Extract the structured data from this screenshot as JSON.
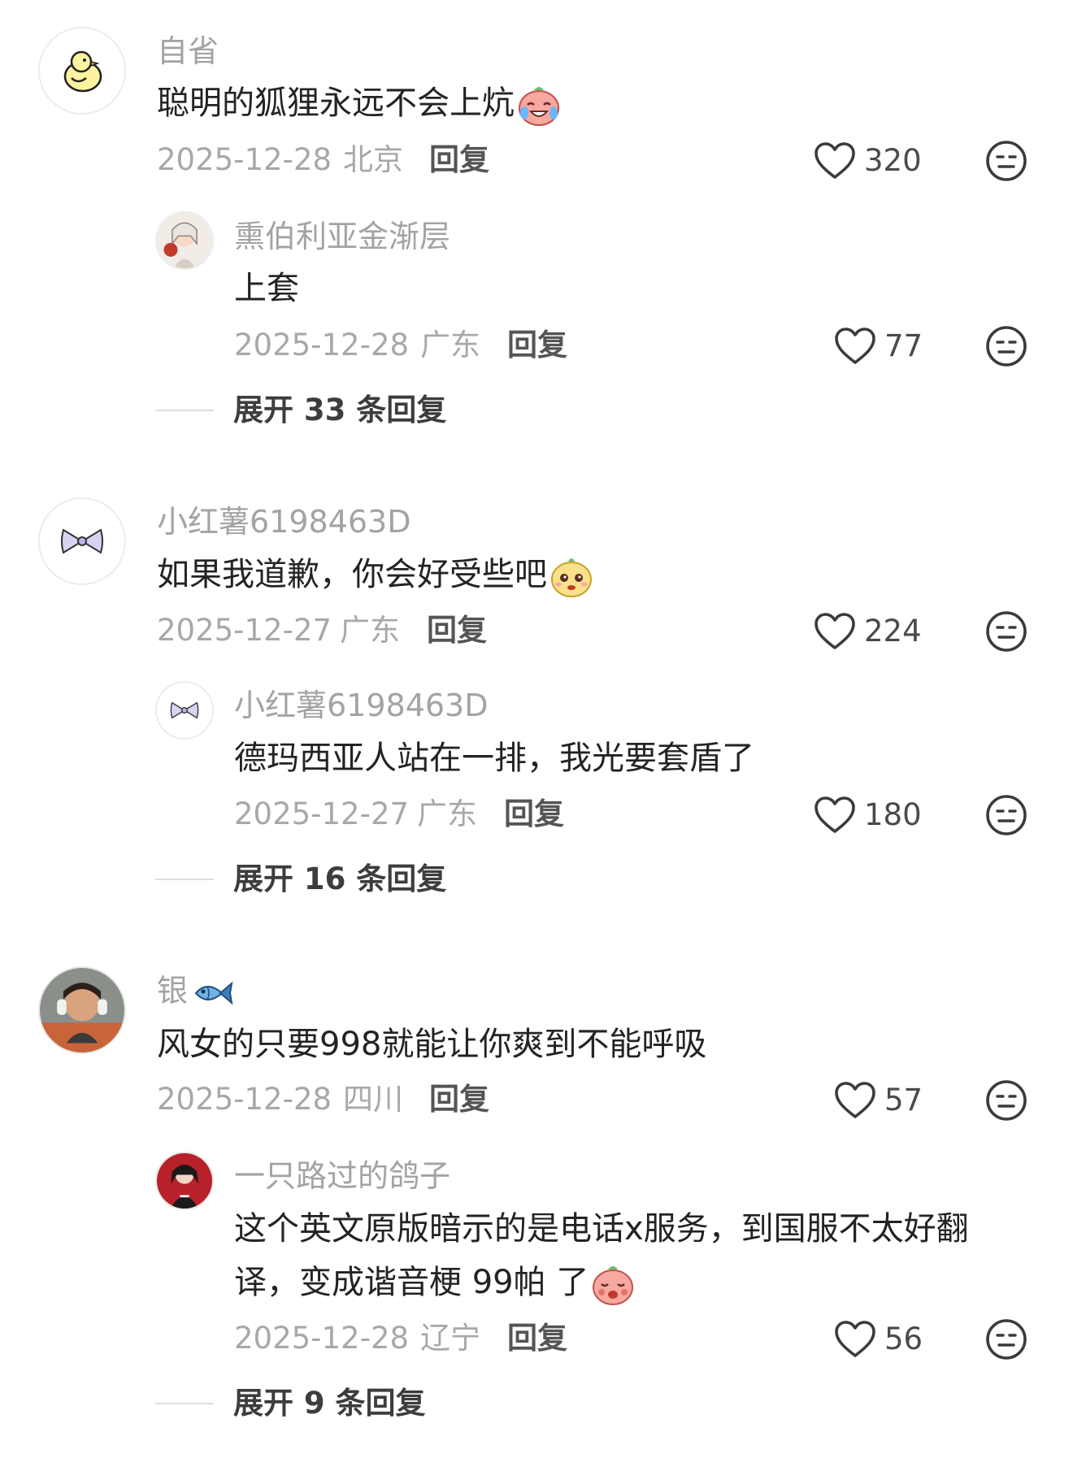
{
  "comments": [
    {
      "username": "自省",
      "text": "聪明的狐狸永远不会上炕",
      "date": "2025-12-28",
      "location": "北京",
      "reply_label": "回复",
      "likes": "320",
      "reply": {
        "username": "熏伯利亚金渐层",
        "text": "上套",
        "date": "2025-12-28",
        "location": "广东",
        "reply_label": "回复",
        "likes": "77"
      },
      "expand_label": "展开 33 条回复"
    },
    {
      "username": "小红薯6198463D",
      "text": "如果我道歉，你会好受些吧",
      "date": "2025-12-27",
      "location": "广东",
      "reply_label": "回复",
      "likes": "224",
      "reply": {
        "username": "小红薯6198463D",
        "text": "德玛西亚人站在一排，我光要套盾了",
        "date": "2025-12-27",
        "location": "广东",
        "reply_label": "回复",
        "likes": "180"
      },
      "expand_label": "展开 16 条回复"
    },
    {
      "username": "银",
      "text": "风女的只要998就能让你爽到不能呼吸",
      "date": "2025-12-28",
      "location": "四川",
      "reply_label": "回复",
      "likes": "57",
      "reply": {
        "username": "一只路过的鸽子",
        "text_line1": "这个英文原版暗示的是电话x服务，到国服不太好翻",
        "text_line2": "译，变成谐音梗 99帕 了",
        "date": "2025-12-28",
        "location": "辽宁",
        "reply_label": "回复",
        "likes": "56"
      },
      "expand_label": "展开 9 条回复"
    }
  ],
  "icons": {
    "like": "heart-outline-icon",
    "dislike": "neutral-face-icon"
  },
  "colors": {
    "username": "#a3a3a3",
    "text": "#232323",
    "meta": "#a8a8a8"
  }
}
